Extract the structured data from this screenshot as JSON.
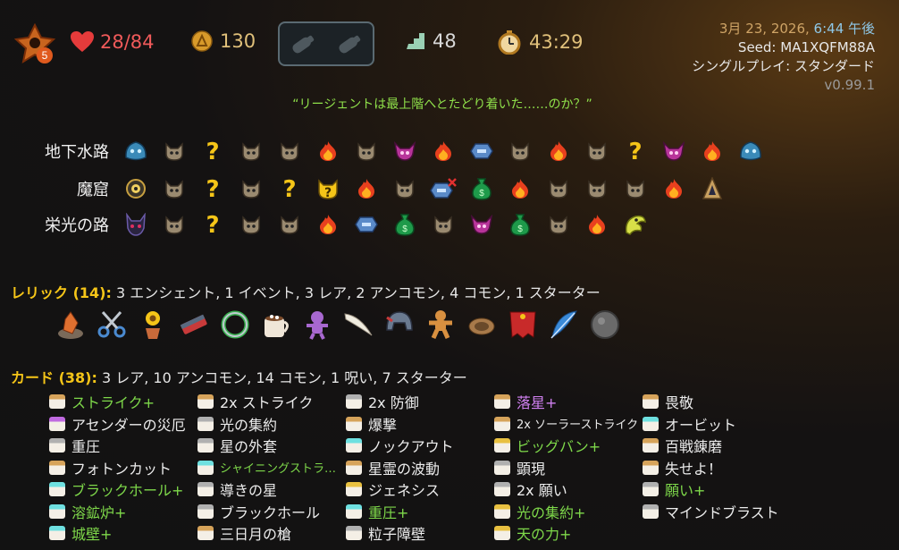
{
  "top": {
    "hp": "28/84",
    "gold": "130",
    "floor": "48",
    "timer": "43:29",
    "char_badge": "5",
    "potions": [
      "potion-slot-empty",
      "potion-slot-empty"
    ]
  },
  "info": {
    "date": "3月 23, 2026, ",
    "time": "6:44 午後",
    "seed": "Seed: MA1XQFM88A",
    "mode": "シングルプレイ: スタンダード",
    "version": "v0.99.1"
  },
  "quote": "“リージェントは最上階へとたどり着いた……のか？”",
  "acts": [
    {
      "label": "地下水路",
      "nodes": [
        "boss-slime",
        "monster",
        "unknown",
        "monster",
        "monster",
        "rest",
        "monster",
        "elite",
        "rest",
        "shop",
        "monster",
        "rest",
        "monster",
        "unknown",
        "elite",
        "rest",
        "boss-slime"
      ]
    },
    {
      "label": "魔窟",
      "nodes": [
        "boss-eye",
        "monster",
        "unknown",
        "monster",
        "unknown",
        "unknown-monster",
        "rest",
        "monster",
        "shop-skip",
        "treasure",
        "rest",
        "monster",
        "monster",
        "monster",
        "rest",
        "ancient"
      ]
    },
    {
      "label": "栄光の路",
      "nodes": [
        "boss-dark",
        "monster",
        "unknown",
        "monster",
        "monster",
        "rest",
        "shop",
        "treasure",
        "monster",
        "elite",
        "treasure",
        "monster",
        "rest",
        "boss-worm"
      ]
    }
  ],
  "relics": {
    "title": "レリック (14):",
    "summary": "3 エンシェント, 1 イベント, 3 レア, 2 アンコモン, 4 コモン, 1 スターター",
    "items": [
      "crystal",
      "scissors",
      "flower-pot",
      "whetstone",
      "ring",
      "cocoa",
      "voodoo-doll",
      "horn",
      "helmet",
      "gingerbread",
      "fireplace",
      "cape",
      "feather",
      "stone-disc"
    ]
  },
  "cards": {
    "title": "カード (38):",
    "summary": "3 レア, 10 アンコモン, 14 コモン, 1 呪い, 7 スターター",
    "columns": [
      [
        {
          "name": "ストライク+",
          "color": "green",
          "icon": "atk"
        },
        {
          "name": "アセンダーの災厄",
          "color": "white",
          "icon": "curse"
        },
        {
          "name": "重圧",
          "color": "white",
          "icon": "skl"
        },
        {
          "name": "フォトンカット",
          "color": "white",
          "icon": "atk"
        },
        {
          "name": "ブラックホール+",
          "color": "green",
          "icon": "up"
        },
        {
          "name": "溶鉱炉+",
          "color": "green",
          "icon": "up"
        },
        {
          "name": "城壁+",
          "color": "green",
          "icon": "up"
        }
      ],
      [
        {
          "name": "2x ストライク",
          "color": "white",
          "icon": "atk"
        },
        {
          "name": "光の集約",
          "color": "white",
          "icon": "skl"
        },
        {
          "name": "星の外套",
          "color": "white",
          "icon": "skl"
        },
        {
          "name": "シャイニングストラ…",
          "color": "green",
          "icon": "up",
          "small": true
        },
        {
          "name": "導きの星",
          "color": "white",
          "icon": "skl"
        },
        {
          "name": "ブラックホール",
          "color": "white",
          "icon": "skl"
        },
        {
          "name": "三日月の槍",
          "color": "white",
          "icon": "atk"
        }
      ],
      [
        {
          "name": "2x 防御",
          "color": "white",
          "icon": "skl"
        },
        {
          "name": "爆撃",
          "color": "white",
          "icon": "atk"
        },
        {
          "name": "ノックアウト",
          "color": "white",
          "icon": "up"
        },
        {
          "name": "星霊の波動",
          "color": "white",
          "icon": "atk"
        },
        {
          "name": "ジェネシス",
          "color": "white",
          "icon": "pow"
        },
        {
          "name": "重圧+",
          "color": "green",
          "icon": "up"
        },
        {
          "name": "粒子障壁",
          "color": "white",
          "icon": "skl"
        }
      ],
      [
        {
          "name": "落星+",
          "color": "purple",
          "icon": "atk"
        },
        {
          "name": "2x ソーラーストライク",
          "color": "white",
          "icon": "atk",
          "small": true
        },
        {
          "name": "ビッグバン+",
          "color": "green",
          "icon": "pow"
        },
        {
          "name": "顕現",
          "color": "white",
          "icon": "skl"
        },
        {
          "name": "2x 願い",
          "color": "white",
          "icon": "skl"
        },
        {
          "name": "光の集約+",
          "color": "green",
          "icon": "pow"
        },
        {
          "name": "天の力+",
          "color": "green",
          "icon": "pow"
        }
      ],
      [
        {
          "name": "畏敬",
          "color": "white",
          "icon": "atk"
        },
        {
          "name": "オービット",
          "color": "white",
          "icon": "up"
        },
        {
          "name": "百戦錬磨",
          "color": "white",
          "icon": "atk"
        },
        {
          "name": "失せよ！",
          "color": "white",
          "icon": "atk"
        },
        {
          "name": "願い+",
          "color": "green",
          "icon": "skl"
        },
        {
          "name": "マインドブラスト",
          "color": "white",
          "icon": "skl"
        }
      ]
    ]
  }
}
